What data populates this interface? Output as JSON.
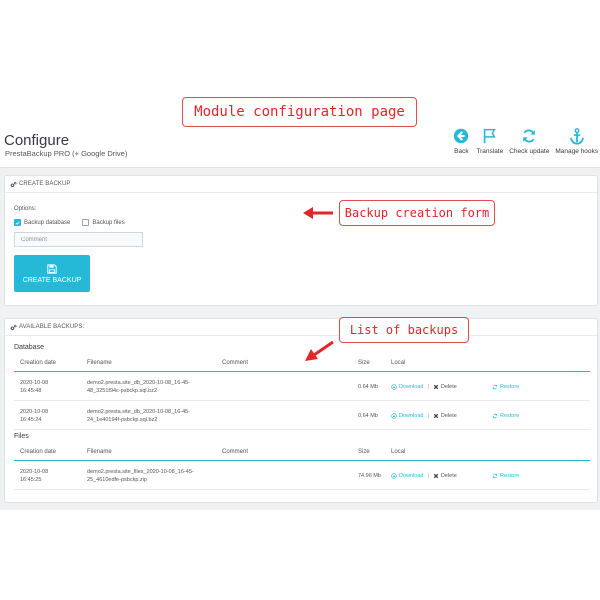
{
  "header": {
    "title": "Configure",
    "subtitle": "PrestaBackup PRO (+ Google Drive)",
    "toolbar": [
      {
        "label": "Back",
        "icon": "back-icon"
      },
      {
        "label": "Translate",
        "icon": "flag-icon"
      },
      {
        "label": "Check update",
        "icon": "refresh-icon"
      },
      {
        "label": "Manage hooks",
        "icon": "anchor-icon"
      }
    ]
  },
  "create_panel": {
    "heading": "CREATE BACKUP",
    "options_label": "Options:",
    "backup_database_label": "Backup database",
    "backup_database_checked": true,
    "backup_files_label": "Backup files",
    "backup_files_checked": false,
    "comment_placeholder": "Comment",
    "create_button_label": "CREATE BACKUP"
  },
  "backups_panel": {
    "heading": "AVAILABLE BACKUPS:",
    "columns": {
      "date": "Creation date",
      "filename": "Filename",
      "comment": "Comment",
      "size": "Size",
      "local": "Local"
    },
    "database": {
      "title": "Database",
      "rows": [
        {
          "date": "2020-10-08 16:45:48",
          "filename": "demo2.presta.site_db_2020-10-08_16-45-48_3251f94c-psbckp.sql.bz2",
          "comment": "",
          "size": "0.64 Mb"
        },
        {
          "date": "2020-10-08 16:45:24",
          "filename": "demo2.presta.site_db_2020-10-08_16-45-24_1e40194f-psbckp.sql.bz2",
          "comment": "",
          "size": "0.64 Mb"
        }
      ]
    },
    "files": {
      "title": "Files",
      "rows": [
        {
          "date": "2020-10-08 16:45:25",
          "filename": "demo2.presta.site_files_2020-10-08_16-45-25_4610edfe-psbckp.zip",
          "comment": "",
          "size": "74.96 Mb"
        }
      ]
    },
    "actions": {
      "download": "Download",
      "delete": "Delete",
      "restore": "Restore",
      "separator": "|"
    }
  },
  "callouts": {
    "module_page": "Module configuration page",
    "backup_form": "Backup creation form",
    "backup_list": "List of backups"
  },
  "colors": {
    "accent": "#25b9d7",
    "callout_red": "#e0262a",
    "background": "#eff1f2"
  }
}
